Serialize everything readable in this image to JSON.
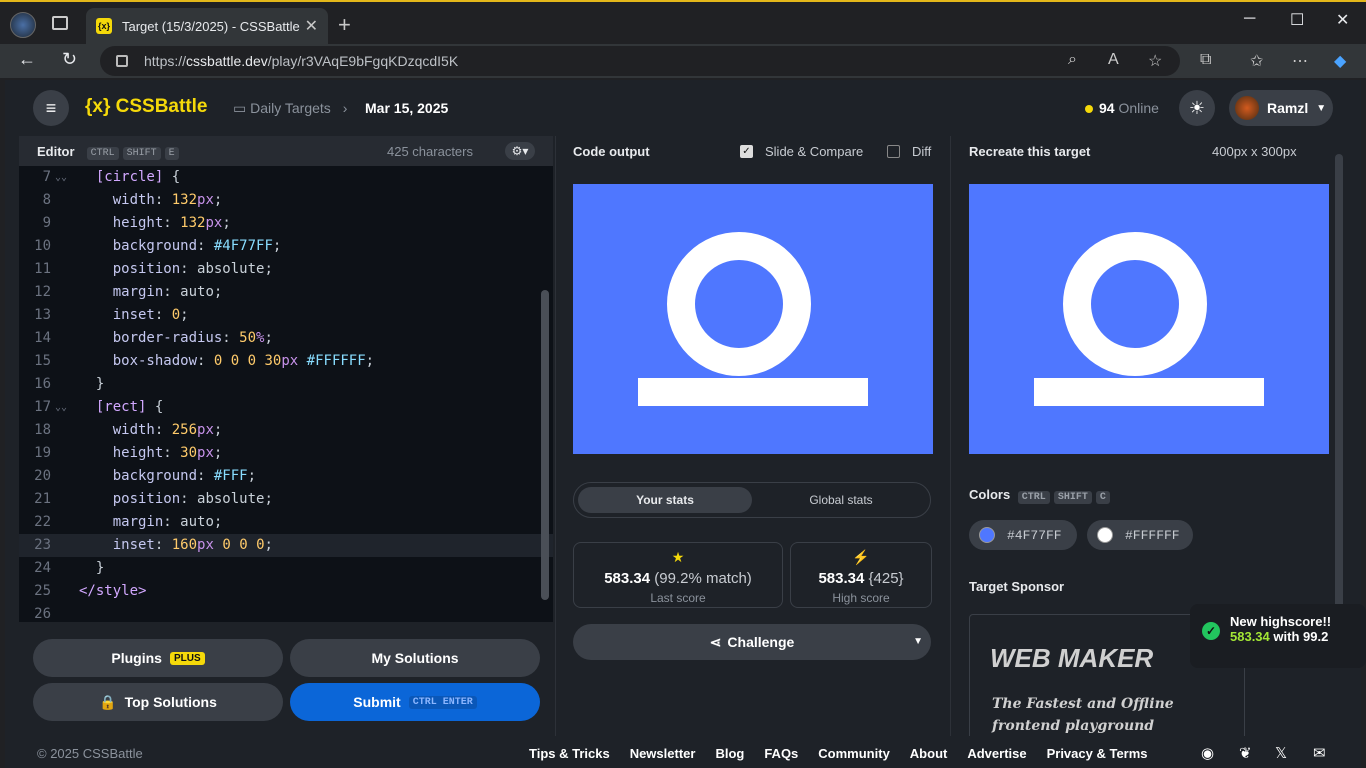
{
  "browser": {
    "tab_title": "Target (15/3/2025) - CSSBattle",
    "url_host": "cssbattle.dev",
    "url_prefix": "https://",
    "url_path": "/play/r3VAqE9bFgqKDzqcdI5K"
  },
  "header": {
    "logo": "{x} CSSBattle",
    "crumb": "Daily Targets",
    "date": "Mar 15, 2025",
    "online_count": "94",
    "online_label": "Online",
    "user": "Ramzl"
  },
  "editor": {
    "title": "Editor",
    "keys": [
      "CTRL",
      "SHIFT",
      "E"
    ],
    "char_count": "425 characters",
    "lines": [
      {
        "n": "7",
        "t": "  [circle] {",
        "fold": true
      },
      {
        "n": "8",
        "t": "    width: 132px;"
      },
      {
        "n": "9",
        "t": "    height: 132px;"
      },
      {
        "n": "10",
        "t": "    background: #4F77FF;"
      },
      {
        "n": "11",
        "t": "    position: absolute;"
      },
      {
        "n": "12",
        "t": "    margin: auto;"
      },
      {
        "n": "13",
        "t": "    inset: 0;"
      },
      {
        "n": "14",
        "t": "    border-radius: 50%;"
      },
      {
        "n": "15",
        "t": "    box-shadow: 0 0 0 30px #FFFFFF;"
      },
      {
        "n": "16",
        "t": "  }"
      },
      {
        "n": "17",
        "t": "  [rect] {",
        "fold": true
      },
      {
        "n": "18",
        "t": "    width: 256px;"
      },
      {
        "n": "19",
        "t": "    height: 30px;"
      },
      {
        "n": "20",
        "t": "    background: #FFF;"
      },
      {
        "n": "21",
        "t": "    position: absolute;"
      },
      {
        "n": "22",
        "t": "    margin: auto;"
      },
      {
        "n": "23",
        "t": "    inset: 160px 0 0 0;",
        "current": true
      },
      {
        "n": "24",
        "t": "  }"
      },
      {
        "n": "25",
        "t": "</style>"
      },
      {
        "n": "26",
        "t": ""
      }
    ]
  },
  "buttons": {
    "plugins": "Plugins",
    "plugins_badge": "PLUS",
    "my_solutions": "My Solutions",
    "top_solutions": "Top Solutions",
    "submit": "Submit",
    "submit_keys": "CTRL  ENTER"
  },
  "output": {
    "title": "Code output",
    "slide_compare": "Slide & Compare",
    "diff": "Diff",
    "slide_checked": true,
    "diff_checked": false
  },
  "stats": {
    "tab_yours": "Your stats",
    "tab_global": "Global stats",
    "last_score": "583.34",
    "last_match": "(99.2% match)",
    "last_label": "Last score",
    "high_score": "583.34",
    "high_chars": "{425}",
    "high_label": "High score",
    "challenge": "Challenge"
  },
  "target": {
    "title": "Recreate this target",
    "size": "400px x 300px",
    "colors_label": "Colors",
    "colors_keys": [
      "CTRL",
      "SHIFT",
      "C"
    ],
    "colors": [
      "#4F77FF",
      "#FFFFFF"
    ],
    "sponsor_label": "Target Sponsor",
    "sponsor_name": "WEB MAKER",
    "sponsor_line1": "The Fastest and Offline",
    "sponsor_line2": "frontend playground"
  },
  "toast": {
    "title": "New highscore!!",
    "score": "583.34",
    "with_text": "with 99.2"
  },
  "footer": {
    "copyright": "© 2025 CSSBattle",
    "links": [
      "Tips & Tricks",
      "Newsletter",
      "Blog",
      "FAQs",
      "Community",
      "About",
      "Advertise",
      "Privacy & Terms"
    ]
  }
}
